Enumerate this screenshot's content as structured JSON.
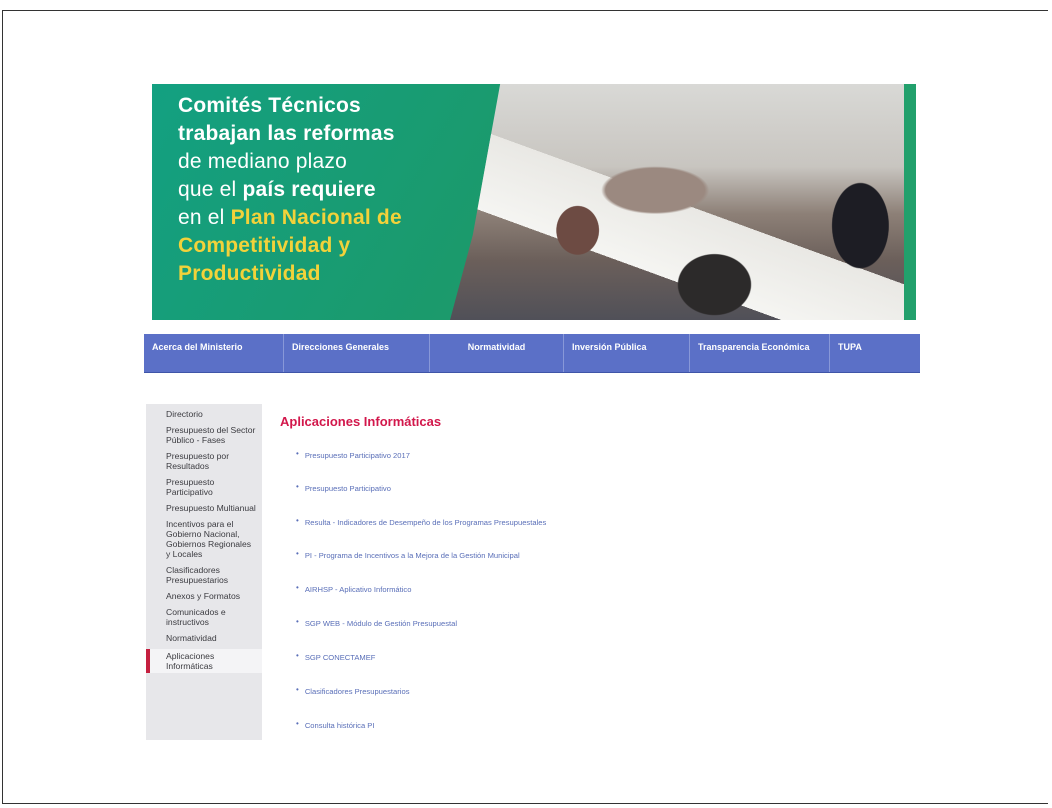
{
  "banner": {
    "line1": "Comités Técnicos",
    "line2": "trabajan las reformas",
    "line3": "de mediano plazo",
    "line4_a": "que el ",
    "line4_b": "país requiere",
    "line5_a": "en el ",
    "line5_b": "Plan Nacional de",
    "line6": "Competitividad y",
    "line7": "Productividad"
  },
  "nav": {
    "items": [
      "Acerca del Ministerio",
      "Direcciones Generales",
      "Normatividad",
      "Inversión Pública",
      "Transparencia Económica",
      "TUPA"
    ]
  },
  "sidebar": {
    "items": [
      "Directorio",
      "Presupuesto del Sector Público - Fases",
      "Presupuesto por Resultados",
      "Presupuesto Participativo",
      "Presupuesto Multianual",
      "Incentivos para el Gobierno Nacional, Gobiernos Regionales y Locales",
      "Clasificadores Presupuestarios",
      "Anexos y Formatos",
      "Comunicados e instructivos",
      "Normatividad",
      "Aplicaciones Informáticas"
    ],
    "active_index": 10
  },
  "main": {
    "title": "Aplicaciones Informáticas",
    "apps": [
      "Presupuesto Participativo 2017",
      "Presupuesto Participativo",
      "Resulta - Indicadores de Desempeño de los Programas Presupuestales",
      "PI - Programa de Incentivos a la Mejora de la Gestión Municipal",
      "AIRHSP - Aplicativo Informático",
      "SGP WEB - Módulo de Gestión Presupuestal",
      "SGP CONECTAMEF",
      "Clasificadores Presupuestarios",
      "Consulta histórica PI"
    ]
  },
  "colors": {
    "nav_bg": "#5b70c7",
    "title_red": "#d2174b",
    "banner_green": "#1b9a6c",
    "banner_yellow": "#f2d23a",
    "link_blue": "#5a6fb8"
  }
}
